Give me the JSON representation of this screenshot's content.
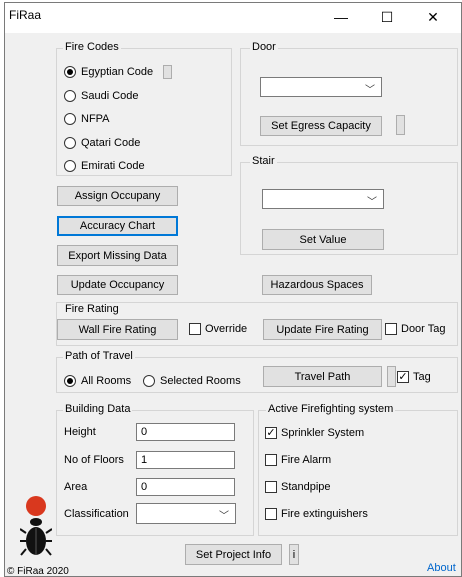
{
  "window": {
    "title": "FiRaa",
    "minimize": "—",
    "maximize": "☐",
    "close": "✕"
  },
  "fire_codes": {
    "label": "Fire Codes",
    "options": [
      "Egyptian Code",
      "Saudi Code",
      "NFPA",
      "Qatari Code",
      "Emirati Code"
    ],
    "selected": "Egyptian Code"
  },
  "door": {
    "label": "Door",
    "select_value": "",
    "set_egress_label": "Set Egress Capacity"
  },
  "stair": {
    "label": "Stair",
    "select_value": "",
    "set_value_label": "Set Value"
  },
  "buttons": {
    "assign_occupancy": "Assign Occupany",
    "accuracy_chart": "Accuracy Chart",
    "export_missing": "Export Missing Data",
    "update_occupancy": "Update Occupancy",
    "hazardous_spaces": "Hazardous Spaces",
    "set_project_info": "Set Project Info",
    "info": "i"
  },
  "fire_rating": {
    "label": "Fire Rating",
    "wall_button": "Wall Fire Rating",
    "override_label": "Override",
    "override_checked": false,
    "update_button": "Update Fire Rating",
    "door_tag_label": "Door Tag",
    "door_tag_checked": false
  },
  "path_of_travel": {
    "label": "Path of Travel",
    "options": [
      "All Rooms",
      "Selected Rooms"
    ],
    "selected": "All Rooms",
    "travel_button": "Travel Path",
    "tag_label": "Tag",
    "tag_checked": true
  },
  "building_data": {
    "label": "Building Data",
    "height_label": "Height",
    "height_value": "0",
    "floors_label": "No of Floors",
    "floors_value": "1",
    "area_label": "Area",
    "area_value": "0",
    "classification_label": "Classification",
    "classification_value": ""
  },
  "firefighting": {
    "label": "Active Firefighting system",
    "items": [
      {
        "label": "Sprinkler System",
        "checked": true
      },
      {
        "label": "Fire Alarm",
        "checked": false
      },
      {
        "label": "Standpipe",
        "checked": false
      },
      {
        "label": "Fire extinguishers",
        "checked": false
      }
    ]
  },
  "footer": {
    "copyright": "© FiRaa 2020",
    "about": "About"
  },
  "colors": {
    "accent": "#0078d7",
    "logo_red": "#d9381e",
    "about_link": "#0066cc"
  }
}
